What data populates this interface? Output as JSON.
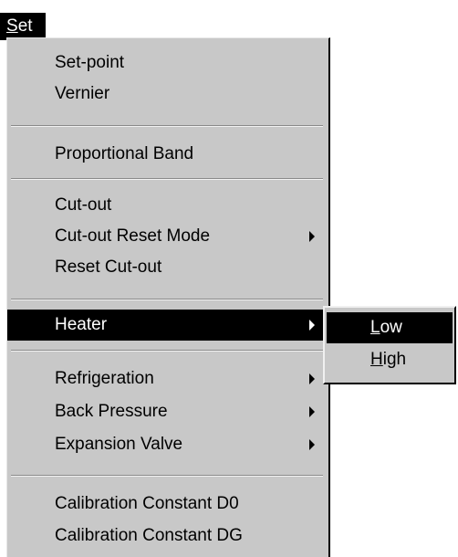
{
  "menubar": {
    "set": {
      "mnemonic": "S",
      "rest": "et"
    }
  },
  "menu": {
    "items": [
      {
        "label": "Set-point",
        "has_submenu": false,
        "selected": false
      },
      {
        "label": "Vernier",
        "has_submenu": false,
        "selected": false
      },
      {
        "label": "Proportional Band",
        "has_submenu": false,
        "selected": false
      },
      {
        "label": "Cut-out",
        "has_submenu": false,
        "selected": false
      },
      {
        "label": "Cut-out Reset Mode",
        "has_submenu": true,
        "selected": false
      },
      {
        "label": "Reset Cut-out",
        "has_submenu": false,
        "selected": false
      },
      {
        "label": "Heater",
        "has_submenu": true,
        "selected": true
      },
      {
        "label": "Refrigeration",
        "has_submenu": true,
        "selected": false
      },
      {
        "label": "Back Pressure",
        "has_submenu": true,
        "selected": false
      },
      {
        "label": "Expansion Valve",
        "has_submenu": true,
        "selected": false
      },
      {
        "label": "Calibration Constant D0",
        "has_submenu": false,
        "selected": false
      },
      {
        "label": "Calibration Constant DG",
        "has_submenu": false,
        "selected": false
      }
    ]
  },
  "heater_submenu": {
    "items": [
      {
        "mnemonic": "L",
        "rest": "ow",
        "selected": true
      },
      {
        "mnemonic": "H",
        "rest": "igh",
        "selected": false
      }
    ]
  },
  "icons": {
    "submenu_arrow": "chevron-right-icon"
  },
  "colors": {
    "menu_background": "#c8c8c8",
    "highlight_background": "#000000",
    "highlight_text": "#ffffff"
  }
}
